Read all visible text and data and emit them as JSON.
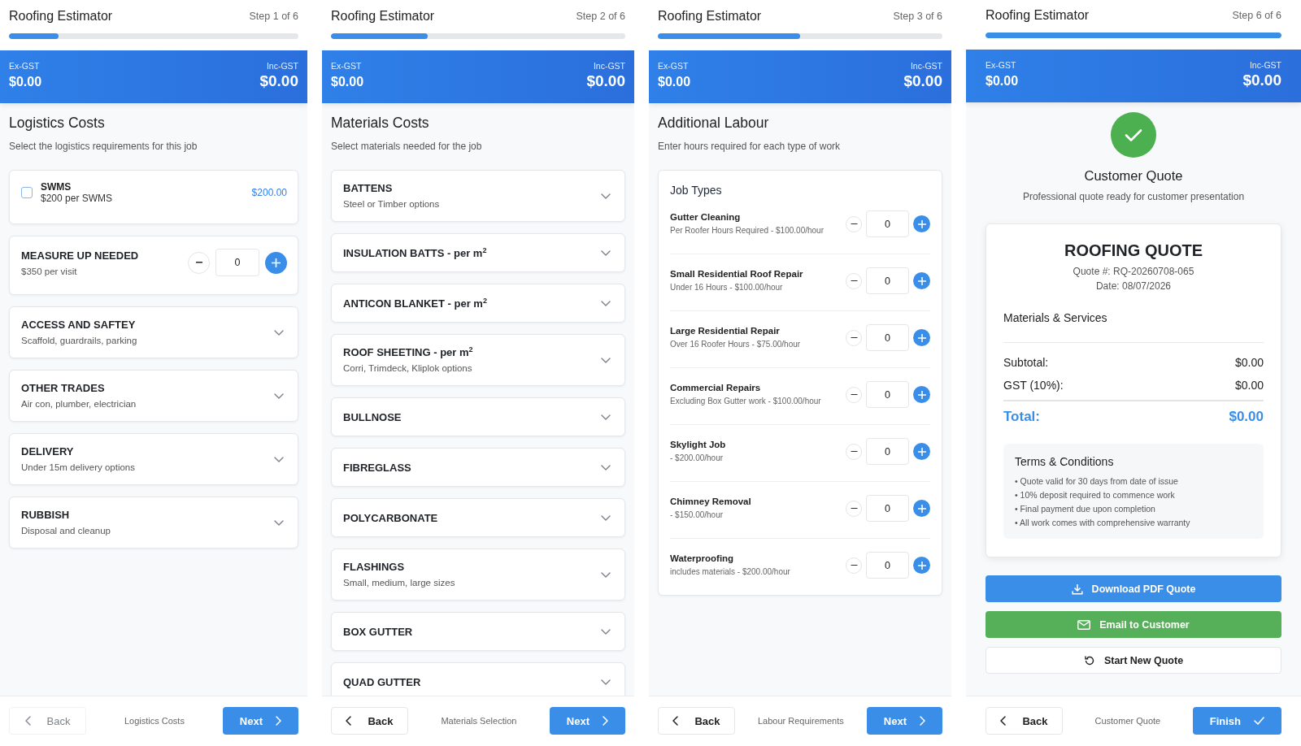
{
  "panels": [
    {
      "kind": "cards",
      "app_title": "Roofing Estimator",
      "step": "Step 1 of 6",
      "progress": {
        "level": 0.17
      },
      "totals": {
        "ex_label": "Ex-GST",
        "ex_value": "$0.00",
        "inc_label": "Inc-GST",
        "inc_value": "$0.00"
      },
      "heading": "Logistics Costs",
      "subheading": "Select the logistics requirements for this job",
      "items": [
        {
          "kind": "checkbox",
          "title": "SWMS",
          "detail": "$200 per SWMS",
          "price": "$200.00",
          "checked": false
        },
        {
          "kind": "counter",
          "title": "MEASURE UP NEEDED",
          "detail": "$350 per visit",
          "value": "0"
        },
        {
          "kind": "accordion",
          "title": "ACCESS AND SAFTEY",
          "detail": "Scaffold, guardrails, parking",
          "expanded": false
        },
        {
          "kind": "accordion",
          "title": "OTHER TRADES",
          "detail": "Air con, plumber, electrician",
          "expanded": false
        },
        {
          "kind": "accordion",
          "title": "DELIVERY",
          "detail": "Under 15m delivery options",
          "expanded": false
        },
        {
          "kind": "accordion",
          "title": "RUBBISH",
          "detail": "Disposal and cleanup",
          "expanded": false
        }
      ],
      "footer": {
        "back": {
          "label": "Back",
          "disabled": true
        },
        "caption": "Logistics Costs",
        "next": {
          "kind": "next",
          "label": "Next"
        }
      }
    },
    {
      "kind": "cards",
      "app_title": "Roofing Estimator",
      "step": "Step 2 of 6",
      "progress": {
        "level": 0.33
      },
      "totals": {
        "ex_label": "Ex-GST",
        "ex_value": "$0.00",
        "inc_label": "Inc-GST",
        "inc_value": "$0.00"
      },
      "heading": "Materials Costs",
      "subheading": "Select materials needed for the job",
      "items": [
        {
          "kind": "accordion",
          "title": "BATTENS",
          "detail": "Steel or Timber options",
          "expanded": false
        },
        {
          "kind": "accordion",
          "title": "INSULATION BATTS - per m$^{2}$",
          "expanded": false
        },
        {
          "kind": "accordion",
          "title": "ANTICON BLANKET - per m$^{2}$",
          "expanded": false
        },
        {
          "kind": "accordion",
          "title": "ROOF SHEETING - per m$^{2}$",
          "detail": "Corri, Trimdeck, Kliplok options",
          "expanded": false
        },
        {
          "kind": "accordion",
          "title": "BULLNOSE",
          "expanded": false
        },
        {
          "kind": "accordion",
          "title": "FIBREGLASS",
          "expanded": false
        },
        {
          "kind": "accordion",
          "title": "POLYCARBONATE",
          "expanded": false
        },
        {
          "kind": "accordion",
          "title": "FLASHINGS",
          "detail": "Small, medium, large sizes",
          "expanded": false
        },
        {
          "kind": "accordion",
          "title": "BOX GUTTER",
          "expanded": false
        },
        {
          "kind": "accordion",
          "title": "QUAD GUTTER",
          "expanded": false
        }
      ],
      "footer": {
        "back": {
          "label": "Back",
          "disabled": false
        },
        "caption": "Materials Selection",
        "next": {
          "kind": "next",
          "label": "Next"
        }
      }
    },
    {
      "kind": "job_types",
      "app_title": "Roofing Estimator",
      "step": "Step 3 of 6",
      "progress": {
        "level": 0.5
      },
      "totals": {
        "ex_label": "Ex-GST",
        "ex_value": "$0.00",
        "inc_label": "Inc-GST",
        "inc_value": "$0.00"
      },
      "heading": "Additional Labour",
      "subheading": "Enter hours required for each type of work",
      "card": {
        "title": "Job Types",
        "rows": [
          {
            "name": "Gutter Cleaning",
            "detail": "Per Roofer Hours Required - $100.00/hour",
            "value": "0"
          },
          {
            "name": "Small Residential Roof Repair",
            "detail": "Under 16 Hours - $100.00/hour",
            "value": "0"
          },
          {
            "name": "Large Residential Repair",
            "detail": "Over 16 Roofer Hours - $75.00/hour",
            "value": "0"
          },
          {
            "name": "Commercial Repairs",
            "detail": "Excluding Box Gutter work - $100.00/hour",
            "value": "0"
          },
          {
            "name": "Skylight Job",
            "detail": "- $200.00/hour",
            "value": "0"
          },
          {
            "name": "Chimney Removal",
            "detail": "- $150.00/hour",
            "value": "0"
          },
          {
            "name": "Waterproofing",
            "detail": "includes materials - $200.00/hour",
            "value": "0"
          }
        ]
      },
      "footer": {
        "back": {
          "label": "Back",
          "disabled": false
        },
        "caption": "Labour Requirements",
        "next": {
          "kind": "next",
          "label": "Next"
        }
      }
    },
    {
      "kind": "quote",
      "app_title": "Roofing Estimator",
      "step": "Step 6 of 6",
      "progress": {
        "level": 1
      },
      "totals": {
        "ex_label": "Ex-GST",
        "ex_value": "$0.00",
        "inc_label": "Inc-GST",
        "inc_value": "$0.00"
      },
      "heading": "Customer Quote",
      "subheading": "Professional quote ready for customer presentation",
      "quote": {
        "title": "ROOFING QUOTE",
        "number": "Quote #: RQ-20260708-065",
        "date": "Date: 08/07/2026",
        "section": "Materials & Services",
        "lines": [
          {
            "label": "Subtotal:",
            "value": "$0.00"
          },
          {
            "label": "GST (10%):",
            "value": "$0.00"
          }
        ],
        "total": {
          "label": "Total:",
          "value": "$0.00"
        },
        "terms": {
          "title": "Terms & Conditions",
          "items": [
            "• Quote valid for 30 days from date of issue",
            "• 10% deposit required to commence work",
            "• Final payment due upon completion",
            "• All work comes with comprehensive warranty"
          ]
        }
      },
      "actions": [
        {
          "kind": "download",
          "label": "Download PDF Quote"
        },
        {
          "kind": "email",
          "label": "Email to Customer"
        },
        {
          "kind": "restart",
          "label": "Start New Quote"
        }
      ],
      "footer": {
        "back": {
          "label": "Back",
          "disabled": false
        },
        "caption": "Customer Quote",
        "next": {
          "kind": "finish",
          "label": "Finish"
        }
      }
    }
  ]
}
